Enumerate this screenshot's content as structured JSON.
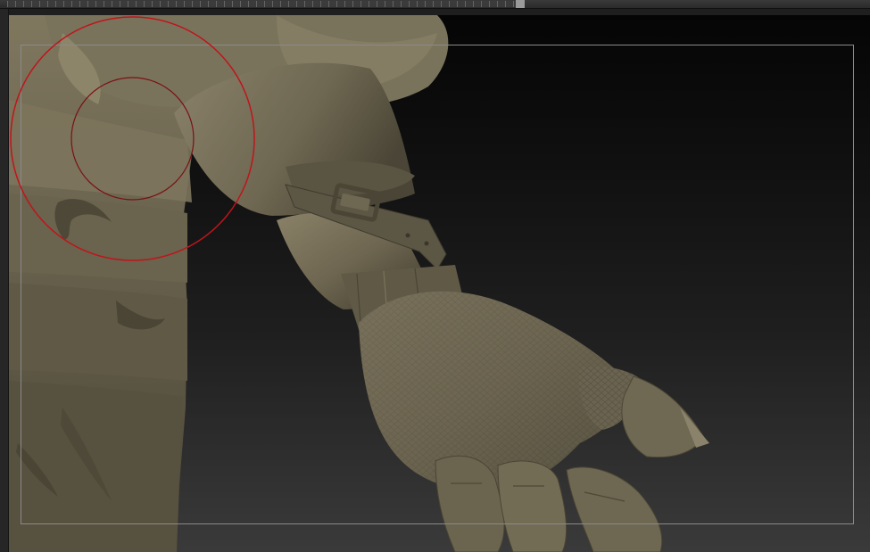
{
  "app": {
    "title": ""
  },
  "viewport": {
    "subject": "sculpted-gloved-hand",
    "background_top": "#050505",
    "background_bottom": "#3a3a3a",
    "clay_color": "#6e6650",
    "frame_guide_color": "#8a8a8a"
  },
  "brush_cursor": {
    "outer_color": "#c0141c",
    "inner_color": "#7a1015",
    "icon": "brush-radius-icon"
  }
}
